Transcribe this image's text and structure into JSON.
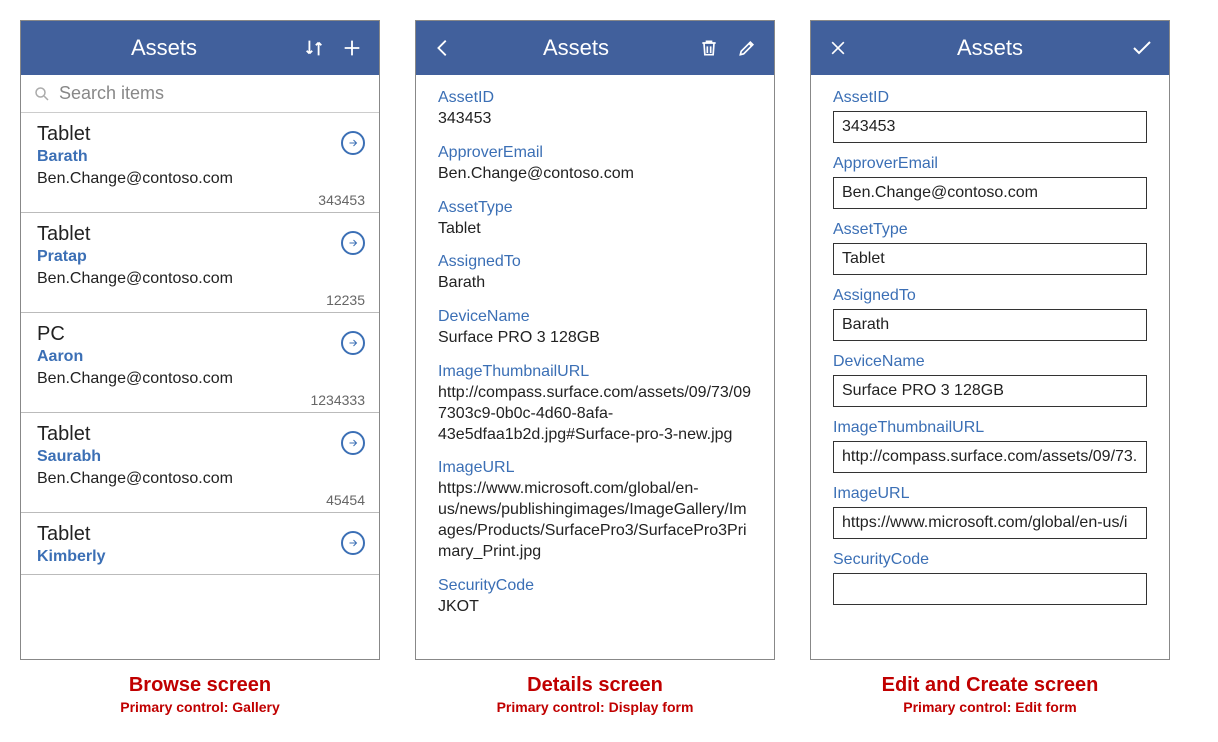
{
  "app_title": "Assets",
  "search_placeholder": "Search items",
  "browse": {
    "items": [
      {
        "type": "Tablet",
        "assigned": "Barath",
        "email": "Ben.Change@contoso.com",
        "id": "343453"
      },
      {
        "type": "Tablet",
        "assigned": "Pratap",
        "email": "Ben.Change@contoso.com",
        "id": "12235"
      },
      {
        "type": "PC",
        "assigned": "Aaron",
        "email": "Ben.Change@contoso.com",
        "id": "1234333"
      },
      {
        "type": "Tablet",
        "assigned": "Saurabh",
        "email": "Ben.Change@contoso.com",
        "id": "45454"
      },
      {
        "type": "Tablet",
        "assigned": "Kimberly",
        "email": "",
        "id": ""
      }
    ]
  },
  "details": {
    "fields": [
      {
        "label": "AssetID",
        "value": "343453"
      },
      {
        "label": "ApproverEmail",
        "value": "Ben.Change@contoso.com"
      },
      {
        "label": "AssetType",
        "value": "Tablet"
      },
      {
        "label": "AssignedTo",
        "value": "Barath"
      },
      {
        "label": "DeviceName",
        "value": "Surface PRO 3 128GB"
      },
      {
        "label": "ImageThumbnailURL",
        "value": "http://compass.surface.com/assets/09/73/097303c9-0b0c-4d60-8afa-43e5dfaa1b2d.jpg#Surface-pro-3-new.jpg"
      },
      {
        "label": "ImageURL",
        "value": "https://www.microsoft.com/global/en-us/news/publishingimages/ImageGallery/Images/Products/SurfacePro3/SurfacePro3Primary_Print.jpg"
      },
      {
        "label": "SecurityCode",
        "value": "JKOT"
      }
    ]
  },
  "edit": {
    "fields": [
      {
        "label": "AssetID",
        "value": "343453"
      },
      {
        "label": "ApproverEmail",
        "value": "Ben.Change@contoso.com"
      },
      {
        "label": "AssetType",
        "value": "Tablet"
      },
      {
        "label": "AssignedTo",
        "value": "Barath"
      },
      {
        "label": "DeviceName",
        "value": "Surface PRO 3 128GB"
      },
      {
        "label": "ImageThumbnailURL",
        "value": "http://compass.surface.com/assets/09/73."
      },
      {
        "label": "ImageURL",
        "value": "https://www.microsoft.com/global/en-us/i"
      },
      {
        "label": "SecurityCode",
        "value": ""
      }
    ]
  },
  "captions": {
    "browse": {
      "title": "Browse screen",
      "sub": "Primary control: Gallery"
    },
    "details": {
      "title": "Details screen",
      "sub": "Primary control: Display form"
    },
    "edit": {
      "title": "Edit and Create screen",
      "sub": "Primary control: Edit form"
    }
  }
}
